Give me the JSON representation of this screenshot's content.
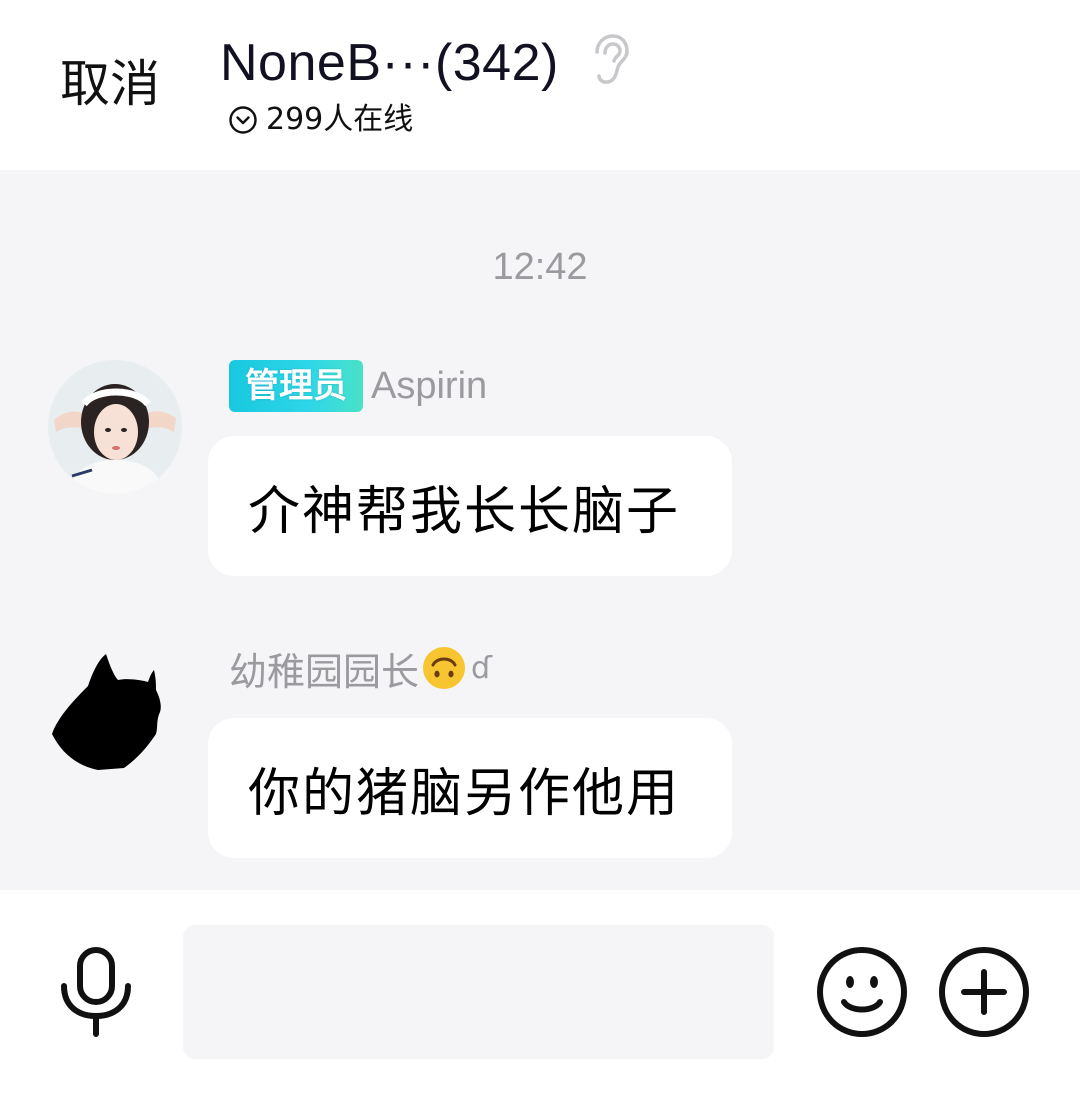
{
  "header": {
    "cancel_label": "取消",
    "title": "NoneB···(342)",
    "online_text": "299人在线",
    "icons": {
      "ear": "ear-icon",
      "online_caret": "chevron-down-circle-icon"
    }
  },
  "chat": {
    "timestamp": "12:42",
    "messages": [
      {
        "badge": "管理员",
        "sender": "Aspirin",
        "text": "介神帮我长长脑子",
        "avatar": "avatar-photo"
      },
      {
        "sender": "幼稚园园长",
        "sender_emoji": "upside-down-face-emoji",
        "sender_suffix": "ɗ",
        "text": "你的猪脑另作他用",
        "avatar": "black-cat-silhouette"
      }
    ]
  },
  "input_bar": {
    "placeholder": "",
    "icons": {
      "mic": "microphone-icon",
      "emoji": "smiley-icon",
      "plus": "plus-circle-icon"
    }
  },
  "colors": {
    "chat_background": "#f5f4f7",
    "badge_gradient_start": "#18c8df",
    "badge_gradient_end": "#49e2c8",
    "muted_text": "#9a9a9f"
  }
}
